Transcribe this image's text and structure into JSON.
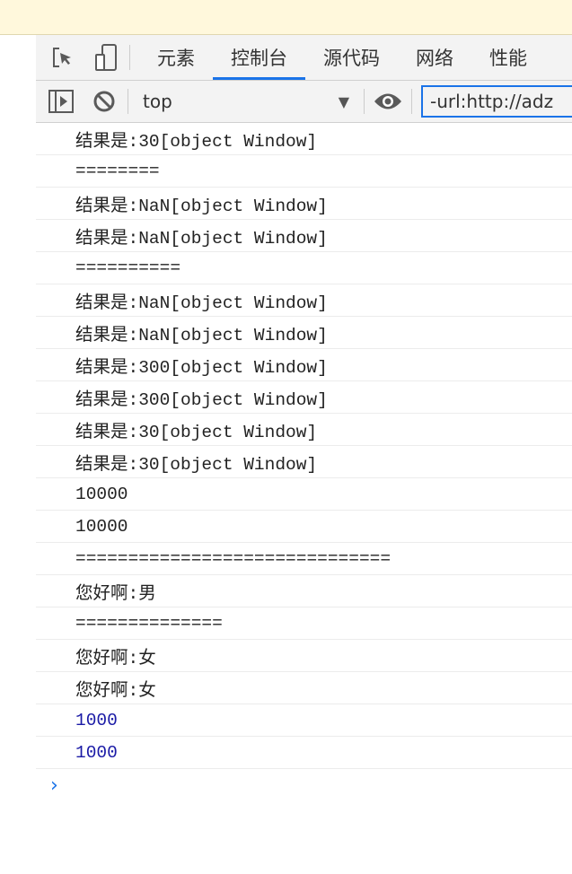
{
  "tabs": [
    {
      "label": "元素"
    },
    {
      "label": "控制台",
      "active": true
    },
    {
      "label": "源代码"
    },
    {
      "label": "网络"
    },
    {
      "label": "性能"
    }
  ],
  "toolbar": {
    "context": "top",
    "filter_value": "-url:http://adz"
  },
  "console": [
    {
      "text": "结果是:30[object Window]",
      "type": "log"
    },
    {
      "text": "========",
      "type": "log"
    },
    {
      "text": "结果是:NaN[object Window]",
      "type": "log"
    },
    {
      "text": "结果是:NaN[object Window]",
      "type": "log"
    },
    {
      "text": "==========",
      "type": "log"
    },
    {
      "text": "结果是:NaN[object Window]",
      "type": "log"
    },
    {
      "text": "结果是:NaN[object Window]",
      "type": "log"
    },
    {
      "text": "结果是:300[object Window]",
      "type": "log"
    },
    {
      "text": "结果是:300[object Window]",
      "type": "log"
    },
    {
      "text": "结果是:30[object Window]",
      "type": "log"
    },
    {
      "text": "结果是:30[object Window]",
      "type": "log"
    },
    {
      "text": "10000",
      "type": "log"
    },
    {
      "text": "10000",
      "type": "log"
    },
    {
      "text": "==============================",
      "type": "log"
    },
    {
      "text": "您好啊:男",
      "type": "log"
    },
    {
      "text": "==============",
      "type": "log"
    },
    {
      "text": "您好啊:女",
      "type": "log"
    },
    {
      "text": "您好啊:女",
      "type": "log"
    },
    {
      "text": "1000",
      "type": "number"
    },
    {
      "text": "1000",
      "type": "number"
    }
  ],
  "colors": {
    "accent": "#1a73e8",
    "number": "#1a1aa6",
    "banner": "#fff8dc"
  }
}
